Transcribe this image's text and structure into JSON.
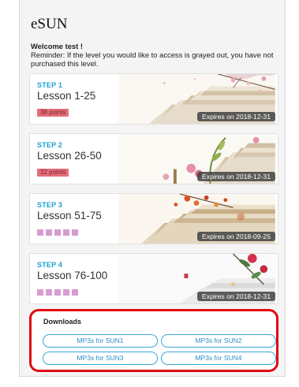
{
  "app": {
    "title": "eSUN"
  },
  "welcome": {
    "title": "Welcome test !",
    "reminder": "Reminder: If the level you would like to access is grayed out, you have not purchased this level."
  },
  "steps": [
    {
      "step": "STEP 1",
      "lesson": "Lesson 1-25",
      "points": "38 points",
      "expires": "Expires on 2018-12-31"
    },
    {
      "step": "STEP 2",
      "lesson": "Lesson 26-50",
      "points": "32 points",
      "expires": "Expires on 2018-12-31"
    },
    {
      "step": "STEP 3",
      "lesson": "Lesson 51-75",
      "expires": "Expires on 2018-09-25"
    },
    {
      "step": "STEP 4",
      "lesson": "Lesson 76-100",
      "expires": "Expires on 2018-12-31"
    }
  ],
  "downloads": {
    "title": "Downloads",
    "buttons": [
      "MP3s for SUN1",
      "MP3s for SUN2",
      "MP3s for SUN3",
      "MP3s for SUN4"
    ]
  },
  "colors": {
    "step_label": "#1e9fd3",
    "points_badge": "#e36f79",
    "progress_square": "#d79cd0",
    "download_border": "#38a6d8",
    "highlight": "#e30613"
  }
}
